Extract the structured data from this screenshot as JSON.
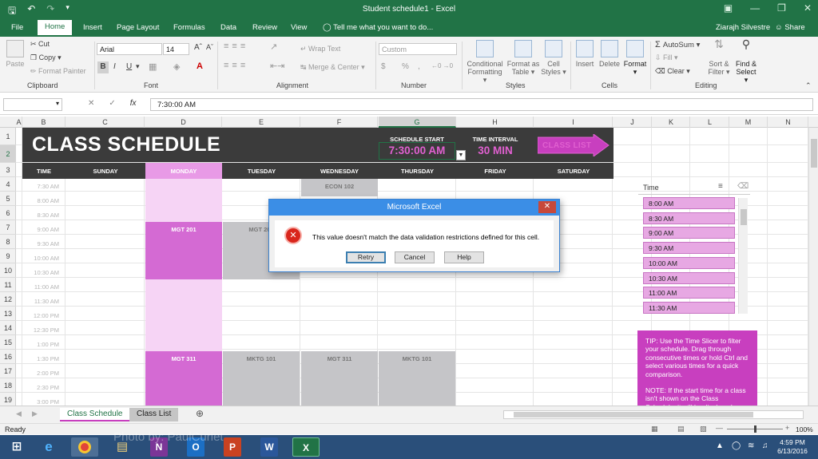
{
  "window": {
    "title": "Student schedule1 - Excel"
  },
  "qat": {
    "save": "save",
    "undo": "undo",
    "redo": "redo",
    "more": "customize"
  },
  "tabs": [
    {
      "label": "File"
    },
    {
      "label": "Home"
    },
    {
      "label": "Insert"
    },
    {
      "label": "Page Layout"
    },
    {
      "label": "Formulas"
    },
    {
      "label": "Data"
    },
    {
      "label": "Review"
    },
    {
      "label": "View"
    }
  ],
  "tellme": "Tell me what you want to do...",
  "user": "Ziarajh Silvestre",
  "share": "Share",
  "ribbon": {
    "clipboard": {
      "paste": "Paste",
      "cut": "Cut",
      "copy": "Copy",
      "format_painter": "Format Painter",
      "label": "Clipboard"
    },
    "font": {
      "name": "Arial",
      "size": "14",
      "label": "Font",
      "bold": "B",
      "italic": "I",
      "underline": "U"
    },
    "alignment": {
      "wrap": "Wrap Text",
      "merge": "Merge & Center",
      "label": "Alignment"
    },
    "number": {
      "format": "Custom",
      "currency": "$",
      "percent": "%",
      "comma": ",",
      "label": "Number"
    },
    "styles": {
      "conditional": "Conditional",
      "conditional2": "Formatting",
      "format_table": "Format as",
      "format_table2": "Table",
      "cell_styles": "Cell",
      "cell_styles2": "Styles",
      "label": "Styles"
    },
    "cells": {
      "insert": "Insert",
      "delete": "Delete",
      "format": "Format",
      "label": "Cells"
    },
    "editing": {
      "autosum": "AutoSum",
      "fill": "Fill",
      "clear": "Clear",
      "sort": "Sort &",
      "sort2": "Filter",
      "find": "Find &",
      "find2": "Select",
      "label": "Editing"
    }
  },
  "formula_bar": {
    "name_box": "",
    "fx": "fx",
    "value": "7:30:00 AM"
  },
  "columns": [
    "A",
    "B",
    "C",
    "D",
    "E",
    "F",
    "G",
    "H",
    "I",
    "J",
    "K",
    "L",
    "M",
    "N"
  ],
  "rows": [
    "1",
    "2",
    "3",
    "4",
    "5",
    "6",
    "7",
    "8",
    "9",
    "10",
    "11",
    "12",
    "13",
    "14",
    "15",
    "16",
    "17",
    "18",
    "19"
  ],
  "schedule": {
    "title": "CLASS SCHEDULE",
    "start_label": "SCHEDULE START",
    "start_value": "7:30:00 AM",
    "interval_label": "TIME INTERVAL",
    "interval_value": "30 MIN",
    "class_list_button": "CLASS LIST",
    "days": [
      "TIME",
      "SUNDAY",
      "MONDAY",
      "TUESDAY",
      "WEDNESDAY",
      "THURSDAY",
      "FRIDAY",
      "SATURDAY"
    ],
    "times": [
      "7:30 AM",
      "8:00 AM",
      "8:30 AM",
      "9:00 AM",
      "9:30 AM",
      "10:00 AM",
      "10:30 AM",
      "11:00 AM",
      "11:30 AM",
      "12:00 PM",
      "12:30 PM",
      "1:00 PM",
      "1:30 PM",
      "2:00 PM",
      "2:30 PM",
      "3:00 PM"
    ],
    "blocks": {
      "econ102": "ECON 102",
      "mgt201": "MGT 201",
      "mgt201_tue": "MGT 201",
      "mgt311": "MGT 311",
      "mktg101_tue": "MKTG 101",
      "mgt311_wed": "MGT 311",
      "mktg101_thu": "MKTG 101"
    }
  },
  "slicer": {
    "title": "Time",
    "items": [
      "8:00 AM",
      "8:30 AM",
      "9:00 AM",
      "9:30 AM",
      "10:00 AM",
      "10:30 AM",
      "11:00 AM",
      "11:30 AM"
    ]
  },
  "tip": {
    "text1": "TIP: Use the Time Slicer to filter your schedule. Drag through consecutive times or hold Ctrl and select various times for a quick comparison.",
    "text2": "NOTE: If the start time for a class isn't shown on the Class Schedule, it will be displayed"
  },
  "sheet_tabs": [
    {
      "label": "Class Schedule"
    },
    {
      "label": "Class List"
    }
  ],
  "status": {
    "mode": "Ready",
    "zoom": "100%"
  },
  "taskbar": {
    "time": "4:59 PM",
    "date": "6/13/2016",
    "watermark": "Photo by: PaulCuriet"
  },
  "dialog": {
    "title": "Microsoft Excel",
    "message": "This value doesn't match the data validation restrictions defined for this cell.",
    "retry": "Retry",
    "cancel": "Cancel",
    "help": "Help"
  },
  "colors": {
    "excel_green": "#217346",
    "band": "#3b3b3b",
    "accent": "#e060d0",
    "monday": "#e89ae6",
    "gray_block": "#c5c5c8",
    "tip": "#c83fbf"
  }
}
